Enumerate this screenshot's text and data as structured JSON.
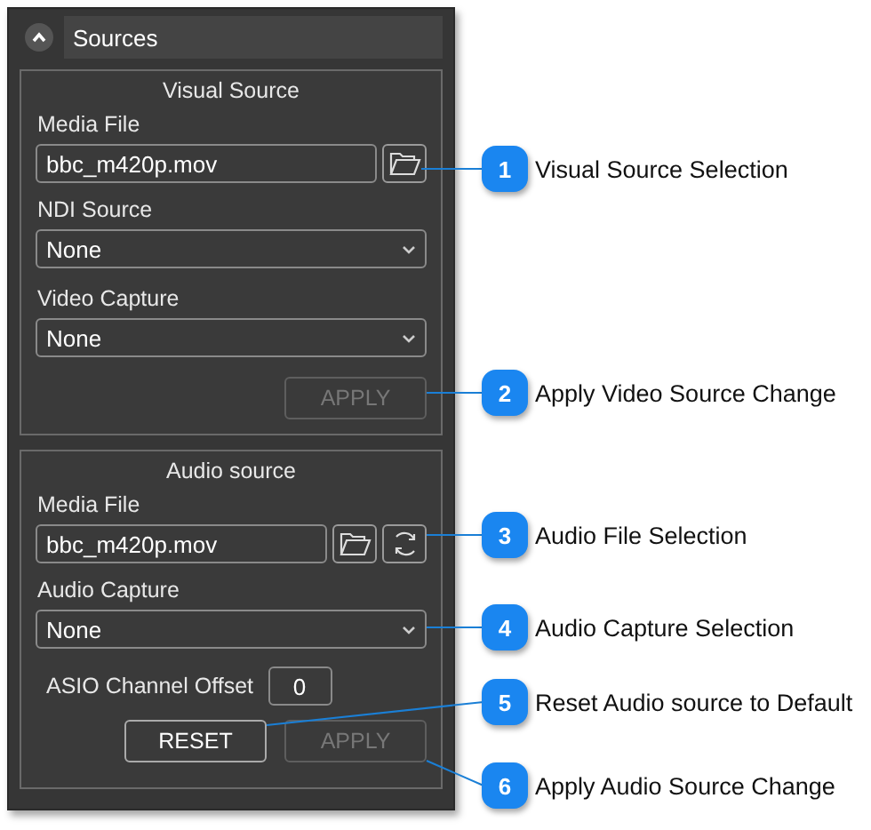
{
  "panel": {
    "title": "Sources",
    "expanded": true
  },
  "visual_source": {
    "title": "Visual Source",
    "media_file": {
      "label": "Media File",
      "value": "bbc_m420p.mov"
    },
    "ndi_source": {
      "label": "NDI Source",
      "value": "None"
    },
    "video_capture": {
      "label": "Video Capture",
      "value": "None"
    },
    "apply_button": {
      "label": "APPLY",
      "disabled": true
    }
  },
  "audio_source": {
    "title": "Audio source",
    "media_file": {
      "label": "Media File",
      "value": "bbc_m420p.mov"
    },
    "audio_capture": {
      "label": "Audio Capture",
      "value": "None"
    },
    "asio_channel_offset": {
      "label": "ASIO Channel Offset",
      "value": "0"
    },
    "reset_button": {
      "label": "RESET",
      "disabled": false
    },
    "apply_button": {
      "label": "APPLY",
      "disabled": true
    }
  },
  "callouts": [
    {
      "number": "1",
      "label": "Visual Source Selection"
    },
    {
      "number": "2",
      "label": "Apply Video Source Change"
    },
    {
      "number": "3",
      "label": "Audio File Selection"
    },
    {
      "number": "4",
      "label": "Audio Capture Selection"
    },
    {
      "number": "5",
      "label": "Reset Audio source to Default"
    },
    {
      "number": "6",
      "label": "Apply Audio Source Change"
    }
  ]
}
